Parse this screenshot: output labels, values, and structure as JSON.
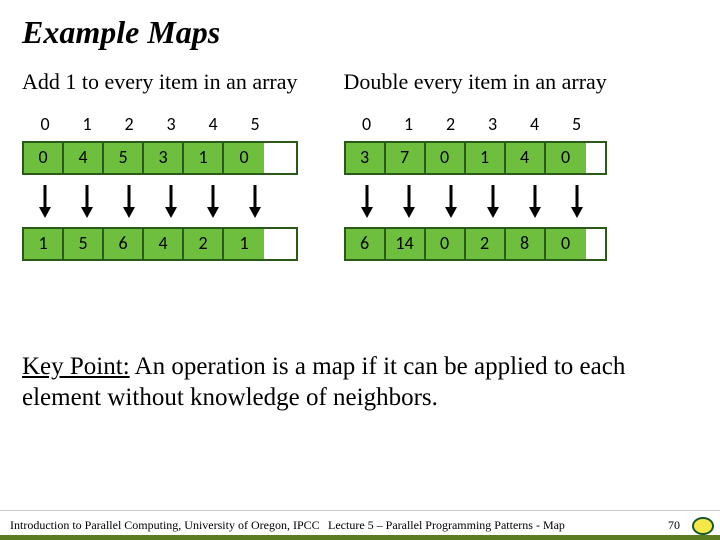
{
  "title": "Example Maps",
  "left": {
    "subtitle": "Add 1 to every item in an array",
    "idx": [
      "0",
      "1",
      "2",
      "3",
      "4",
      "5"
    ],
    "before": [
      "0",
      "4",
      "5",
      "3",
      "1",
      "0"
    ],
    "after": [
      "1",
      "5",
      "6",
      "4",
      "2",
      "1"
    ]
  },
  "right": {
    "subtitle": "Double every item in an array",
    "idx": [
      "0",
      "1",
      "2",
      "3",
      "4",
      "5"
    ],
    "before": [
      "3",
      "7",
      "0",
      "1",
      "4",
      "0"
    ],
    "after": [
      "6",
      "14",
      "0",
      "2",
      "8",
      "0"
    ]
  },
  "keypoint_label": "Key Point:",
  "keypoint_text": " An operation is a map if it can be applied to each element without knowledge of neighbors.",
  "footer": {
    "left": "Introduction to Parallel Computing, University of Oregon, IPCC",
    "mid": "Lecture 5 – Parallel Programming Patterns - Map",
    "page": "70"
  }
}
